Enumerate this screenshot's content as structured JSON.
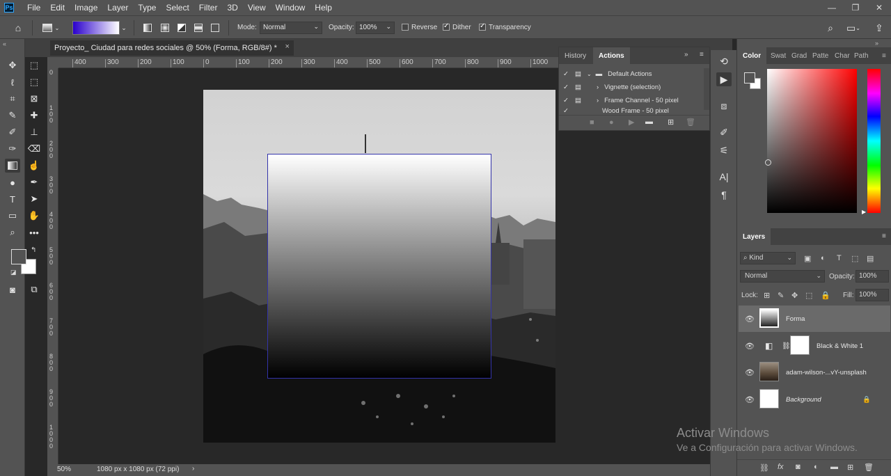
{
  "menu": [
    "File",
    "Edit",
    "Image",
    "Layer",
    "Type",
    "Select",
    "Filter",
    "3D",
    "View",
    "Window",
    "Help"
  ],
  "app_logo": "Ps",
  "options": {
    "mode_label": "Mode:",
    "mode_value": "Normal",
    "opacity_label": "Opacity:",
    "opacity_value": "100%",
    "reverse_label": "Reverse",
    "dither_label": "Dither",
    "transparency_label": "Transparency",
    "gradient_colors": [
      "#2a00cc",
      "#ffffff"
    ]
  },
  "document": {
    "tab_title": "Proyecto_ Ciudad para redes sociales @ 50% (Forma, RGB/8#) *",
    "close": "×",
    "zoom": "50%",
    "size_info": "1080 px x 1080 px (72 ppi)"
  },
  "ruler_h": [
    "400",
    "300",
    "200",
    "100",
    "0",
    "100",
    "200",
    "300",
    "400",
    "500",
    "600",
    "700",
    "800",
    "900",
    "1000"
  ],
  "ruler_v": [
    "0",
    "100",
    "200",
    "300",
    "400",
    "500",
    "600",
    "700",
    "800",
    "900",
    "1000"
  ],
  "actions_panel": {
    "tabs": [
      "History",
      "Actions"
    ],
    "rows": [
      "Default Actions",
      "Vignette (selection)",
      "Frame Channel - 50 pixel",
      "Wood Frame - 50 pixel"
    ]
  },
  "color_panel": {
    "tabs": [
      "Color",
      "Swat",
      "Grad",
      "Patte",
      "Char",
      "Path"
    ]
  },
  "layers_panel": {
    "title": "Layers",
    "kind_label": "Kind",
    "blend_mode": "Normal",
    "opacity_label": "Opacity:",
    "opacity_value": "100%",
    "lock_label": "Lock:",
    "fill_label": "Fill:",
    "fill_value": "100%",
    "layers": [
      {
        "name": "Forma",
        "selected": true
      },
      {
        "name": "Black & White 1",
        "selected": false
      },
      {
        "name": "adam-wilson-...vY-unsplash",
        "selected": false
      },
      {
        "name": "Background",
        "selected": false
      }
    ]
  },
  "watermark": {
    "line1": "Activar Windows",
    "line2": "Ve a Configuración para activar Windows."
  }
}
